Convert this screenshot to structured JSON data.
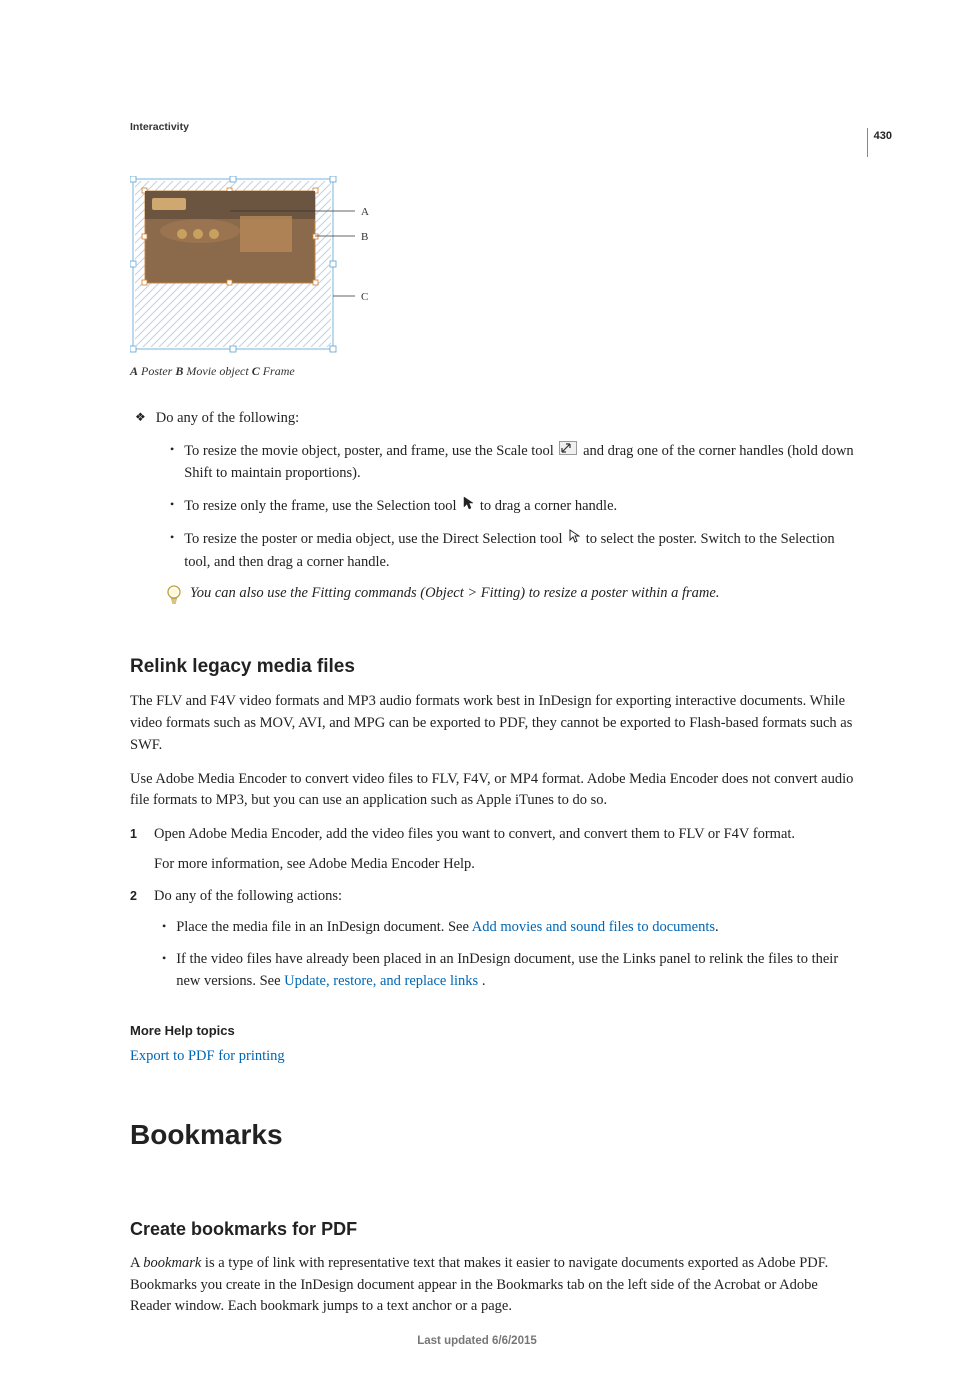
{
  "page_number": "430",
  "section_label": "Interactivity",
  "figure_caption": {
    "a_letter": "A",
    "a_text": " Poster  ",
    "b_letter": "B",
    "b_text": " Movie object  ",
    "c_letter": "C",
    "c_text": " Frame"
  },
  "body": {
    "do_any": "Do any of the following:",
    "bullet1_a": "To resize the movie object, poster, and frame, use the Scale tool ",
    "bullet1_b": " and drag one of the corner handles (hold down Shift to maintain proportions).",
    "bullet2_a": "To resize only the frame, use the Selection tool ",
    "bullet2_b": " to drag a corner handle.",
    "bullet3_a": "To resize the poster or media object, use the Direct Selection tool ",
    "bullet3_b": " to select the poster. Switch to the Selection tool, and then drag a corner handle.",
    "tip": "You can also use the Fitting commands (Object > Fitting) to resize a poster within a frame."
  },
  "relink": {
    "heading": "Relink legacy media files",
    "p1": "The FLV and F4V video formats and MP3 audio formats work best in InDesign for exporting interactive documents. While video formats such as MOV, AVI, and MPG can be exported to PDF, they cannot be exported to Flash-based formats such as SWF.",
    "p2": "Use Adobe Media Encoder to convert video files to FLV, F4V, or MP4 format. Adobe Media Encoder does not convert audio file formats to MP3, but you can use an application such as Apple iTunes to do so.",
    "step1_a": "Open Adobe Media Encoder, add the video files you want to convert, and convert them to FLV or F4V format.",
    "step1_b": "For more information, see Adobe Media Encoder Help.",
    "step2": "Do any of the following actions:",
    "step2_a_pre": "Place the media file in an InDesign document. See ",
    "step2_a_link": "Add movies and sound files to documents",
    "step2_a_post": ".",
    "step2_b_pre": "If the video files have already been placed in an InDesign document, use the Links panel to relink the files to their new versions. See ",
    "step2_b_link": "Update, restore, and replace links",
    "step2_b_post": " ."
  },
  "more_help": {
    "heading": "More Help topics",
    "link": "Export to PDF for printing"
  },
  "bookmarks": {
    "h1": "Bookmarks",
    "h2": "Create bookmarks for PDF",
    "p_pre": "A ",
    "p_italic": "bookmark",
    "p_post": " is a type of link with representative text that makes it easier to navigate documents exported as Adobe PDF. Bookmarks you create in the InDesign document appear in the Bookmarks tab on the left side of the Acrobat or Adobe Reader window. Each bookmark jumps to a text anchor or a page."
  },
  "footer": "Last updated 6/6/2015",
  "callouts": {
    "A": "A",
    "B": "B",
    "C": "C"
  }
}
